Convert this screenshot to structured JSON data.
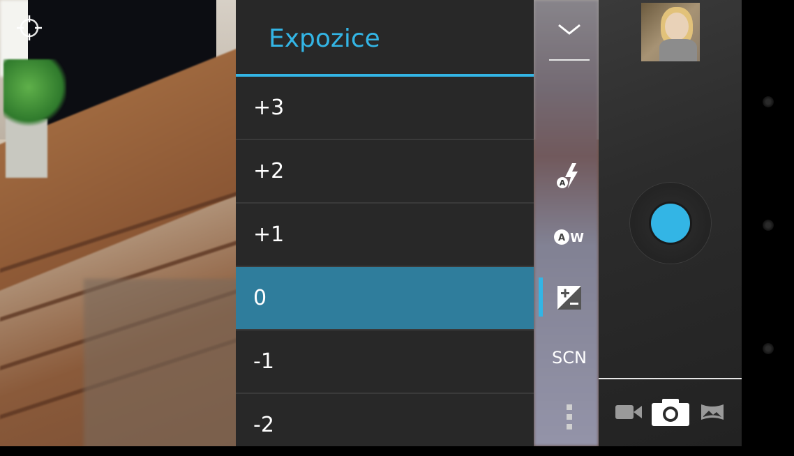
{
  "exposure": {
    "title": "Expozice",
    "options": [
      "+3",
      "+2",
      "+1",
      "0",
      "-1",
      "-2"
    ],
    "selected": "0"
  },
  "settings": {
    "scene_label": "SCN",
    "items": [
      "collapse-icon",
      "flash-auto-icon",
      "white-balance-auto-icon",
      "exposure-icon",
      "scene-mode",
      "more-icon"
    ]
  },
  "controls": {
    "modes": [
      "video-camera-icon",
      "photo-camera-icon",
      "panorama-icon"
    ],
    "active_mode": "photo-camera-icon"
  },
  "colors": {
    "accent": "#33b5e5",
    "selected_row": "#2f7d9c",
    "panel_bg": "#282828"
  }
}
